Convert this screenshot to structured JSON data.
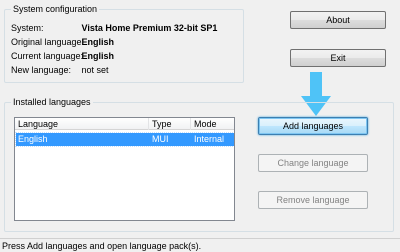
{
  "system_config": {
    "title": "System configuration",
    "rows": [
      {
        "label": "System:",
        "value": "Vista Home Premium 32-bit SP1",
        "bold": true
      },
      {
        "label": "Original language:",
        "value": "English",
        "bold": true
      },
      {
        "label": "Current language:",
        "value": "English",
        "bold": true
      },
      {
        "label": "New language:",
        "value": "not set",
        "bold": false
      }
    ]
  },
  "buttons": {
    "about": "About",
    "exit": "Exit",
    "add_languages": "Add languages",
    "change_language": "Change language",
    "remove_language": "Remove language"
  },
  "installed": {
    "title": "Installed languages",
    "columns": [
      "Language",
      "Type",
      "Mode"
    ],
    "rows": [
      {
        "language": "English",
        "type": "MUI",
        "mode": "Internal"
      }
    ]
  },
  "status_text": "Press Add languages and open language pack(s).",
  "colors": {
    "selection": "#3399ff",
    "hint_arrow": "#4fc3f7",
    "primary_border": "#3c7fb1"
  },
  "icons": {
    "hint_arrow": "arrow-down-icon"
  }
}
